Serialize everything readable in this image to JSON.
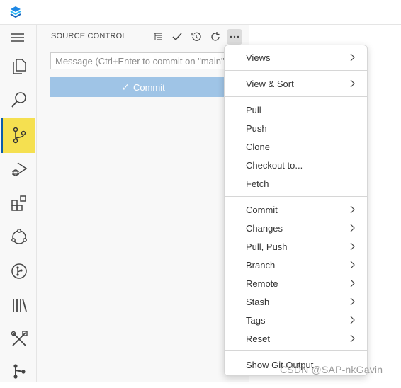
{
  "sidebar": {
    "title": "SOURCE CONTROL",
    "commit_placeholder": "Message (Ctrl+Enter to commit on \"main\")",
    "commit_button": "Commit"
  },
  "activity_bar": {
    "items": [
      {
        "icon": "explorer-icon"
      },
      {
        "icon": "search-icon"
      },
      {
        "icon": "source-control-icon",
        "active": true
      },
      {
        "icon": "run-debug-icon"
      },
      {
        "icon": "extensions-icon"
      },
      {
        "icon": "remote-icon"
      },
      {
        "icon": "git-graph-icon"
      },
      {
        "icon": "library-icon"
      },
      {
        "icon": "tools-icon"
      },
      {
        "icon": "git-icon"
      }
    ]
  },
  "context_menu": {
    "views": "Views",
    "view_sort": "View & Sort",
    "pull": "Pull",
    "push": "Push",
    "clone": "Clone",
    "checkout": "Checkout to...",
    "fetch": "Fetch",
    "commit": "Commit",
    "changes": "Changes",
    "pull_push": "Pull, Push",
    "branch": "Branch",
    "remote": "Remote",
    "stash": "Stash",
    "tags": "Tags",
    "reset": "Reset",
    "show_git_output": "Show Git Output"
  },
  "watermark": "CSDN @SAP-nkGavin",
  "colors": {
    "active_item": "#f5e050",
    "commit_button": "#9fc4e6",
    "accent": "#0b5cab"
  }
}
